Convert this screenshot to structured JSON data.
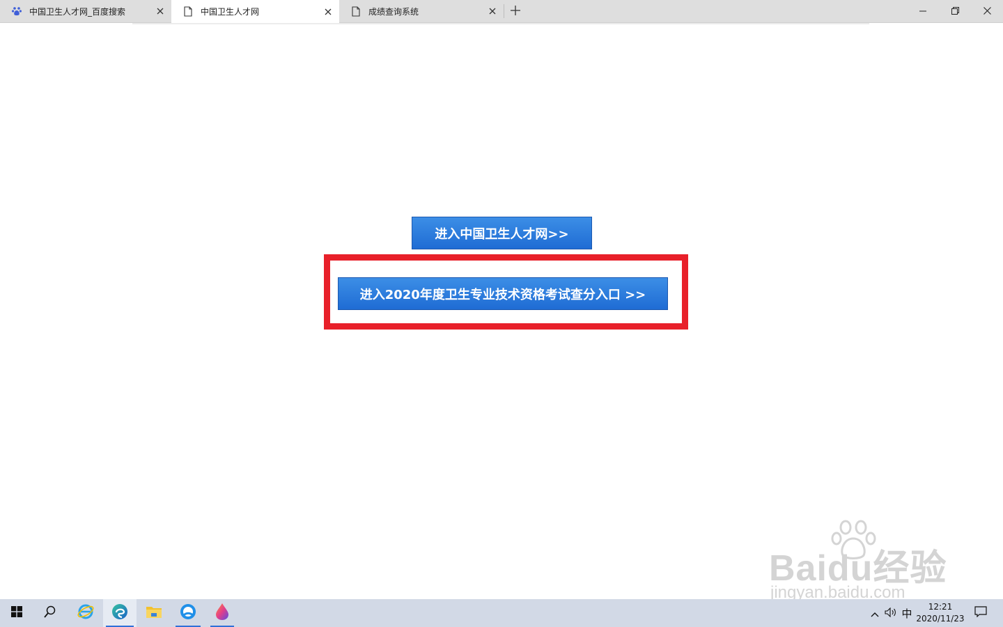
{
  "browser": {
    "tabs": [
      {
        "title": "中国卫生人才网_百度搜索",
        "icon": "baidu-paw-icon"
      },
      {
        "title": "中国卫生人才网",
        "icon": "page-icon",
        "active": true
      },
      {
        "title": "成绩查询系统",
        "icon": "page-icon"
      }
    ]
  },
  "page": {
    "button_main": "进入中国卫生人才网>>",
    "button_exam": "进入2020年度卫生专业技术资格考试查分入口 >>"
  },
  "watermark": {
    "main": "Baidu经验",
    "sub": "jingyan.baidu.com"
  },
  "taskbar": {
    "ime": "中",
    "time": "12:21",
    "date": "2020/11/23"
  },
  "colors": {
    "button_blue": "#1f6cd4",
    "highlight_red": "#e8202a",
    "taskbar_bg": "#d2d9e6"
  }
}
